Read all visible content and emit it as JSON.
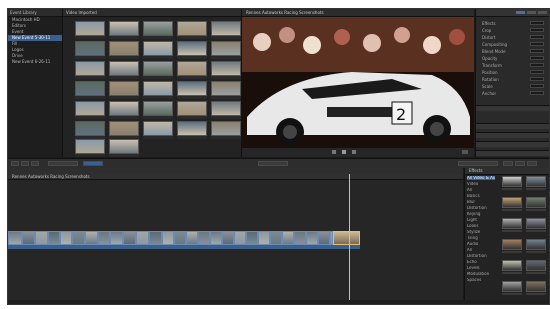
{
  "library": {
    "header": "Event Library",
    "items": [
      {
        "label": "Macintosh HD"
      },
      {
        "label": "Editors"
      },
      {
        "label": "Event"
      },
      {
        "label": "New Event 5-30-11"
      },
      {
        "label": "Fill"
      },
      {
        "label": "Logos"
      },
      {
        "label": "Drive"
      },
      {
        "label": "New Event 6-26-11"
      }
    ]
  },
  "browser": {
    "header": "Video Imported"
  },
  "viewer": {
    "title": "Rennes Autoworks Racing Screenshots"
  },
  "timeline": {
    "header": "Rennes Autoworks Racing Screenshots"
  },
  "effects": {
    "header": "Effects",
    "categories": [
      "All Video & Audio",
      "Video",
      "All",
      "Basics",
      "Blur",
      "Distortion",
      "Keying",
      "Light",
      "Looks",
      "Stylize",
      "Tiling",
      "Audio",
      "All",
      "Distortion",
      "Echo",
      "Levels",
      "Modulation",
      "Spaces"
    ]
  },
  "inspector": {
    "rows": [
      "Effects",
      "Crop",
      "Distort",
      "Compositing",
      "Blend Mode",
      "Opacity",
      "Transform",
      "Position",
      "Rotation",
      "Scale",
      "Anchor"
    ]
  },
  "colors": {
    "accent": "#3b5f8f",
    "playhead": "#e0c070",
    "clip_border": "#6a8bb5"
  }
}
